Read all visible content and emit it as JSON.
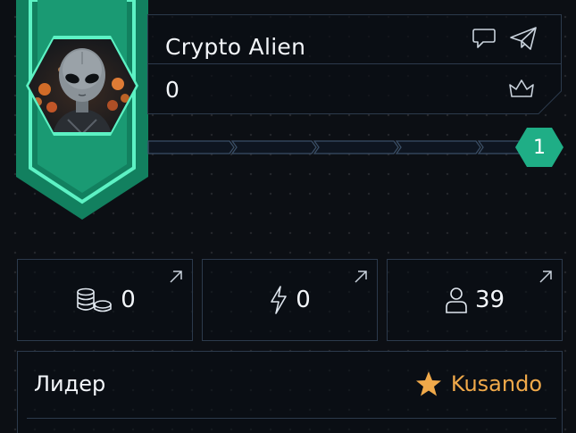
{
  "profile": {
    "name": "Crypto Alien",
    "score": "0",
    "level": "1",
    "avatar_icon": "alien-avatar",
    "accent_color": "#1fae86",
    "accent_light": "#59f0c2"
  },
  "header_actions": {
    "chat_icon": "chat-icon",
    "send_icon": "send-icon",
    "rank_icon": "crown-icon"
  },
  "stats": [
    {
      "icon": "coins-icon",
      "value": "0"
    },
    {
      "icon": "lightning-icon",
      "value": "0"
    },
    {
      "icon": "user-icon",
      "value": "39"
    }
  ],
  "leader": {
    "label": "Лидер",
    "name": "Kusando",
    "icon": "star-icon",
    "name_color": "#f0a94a"
  }
}
